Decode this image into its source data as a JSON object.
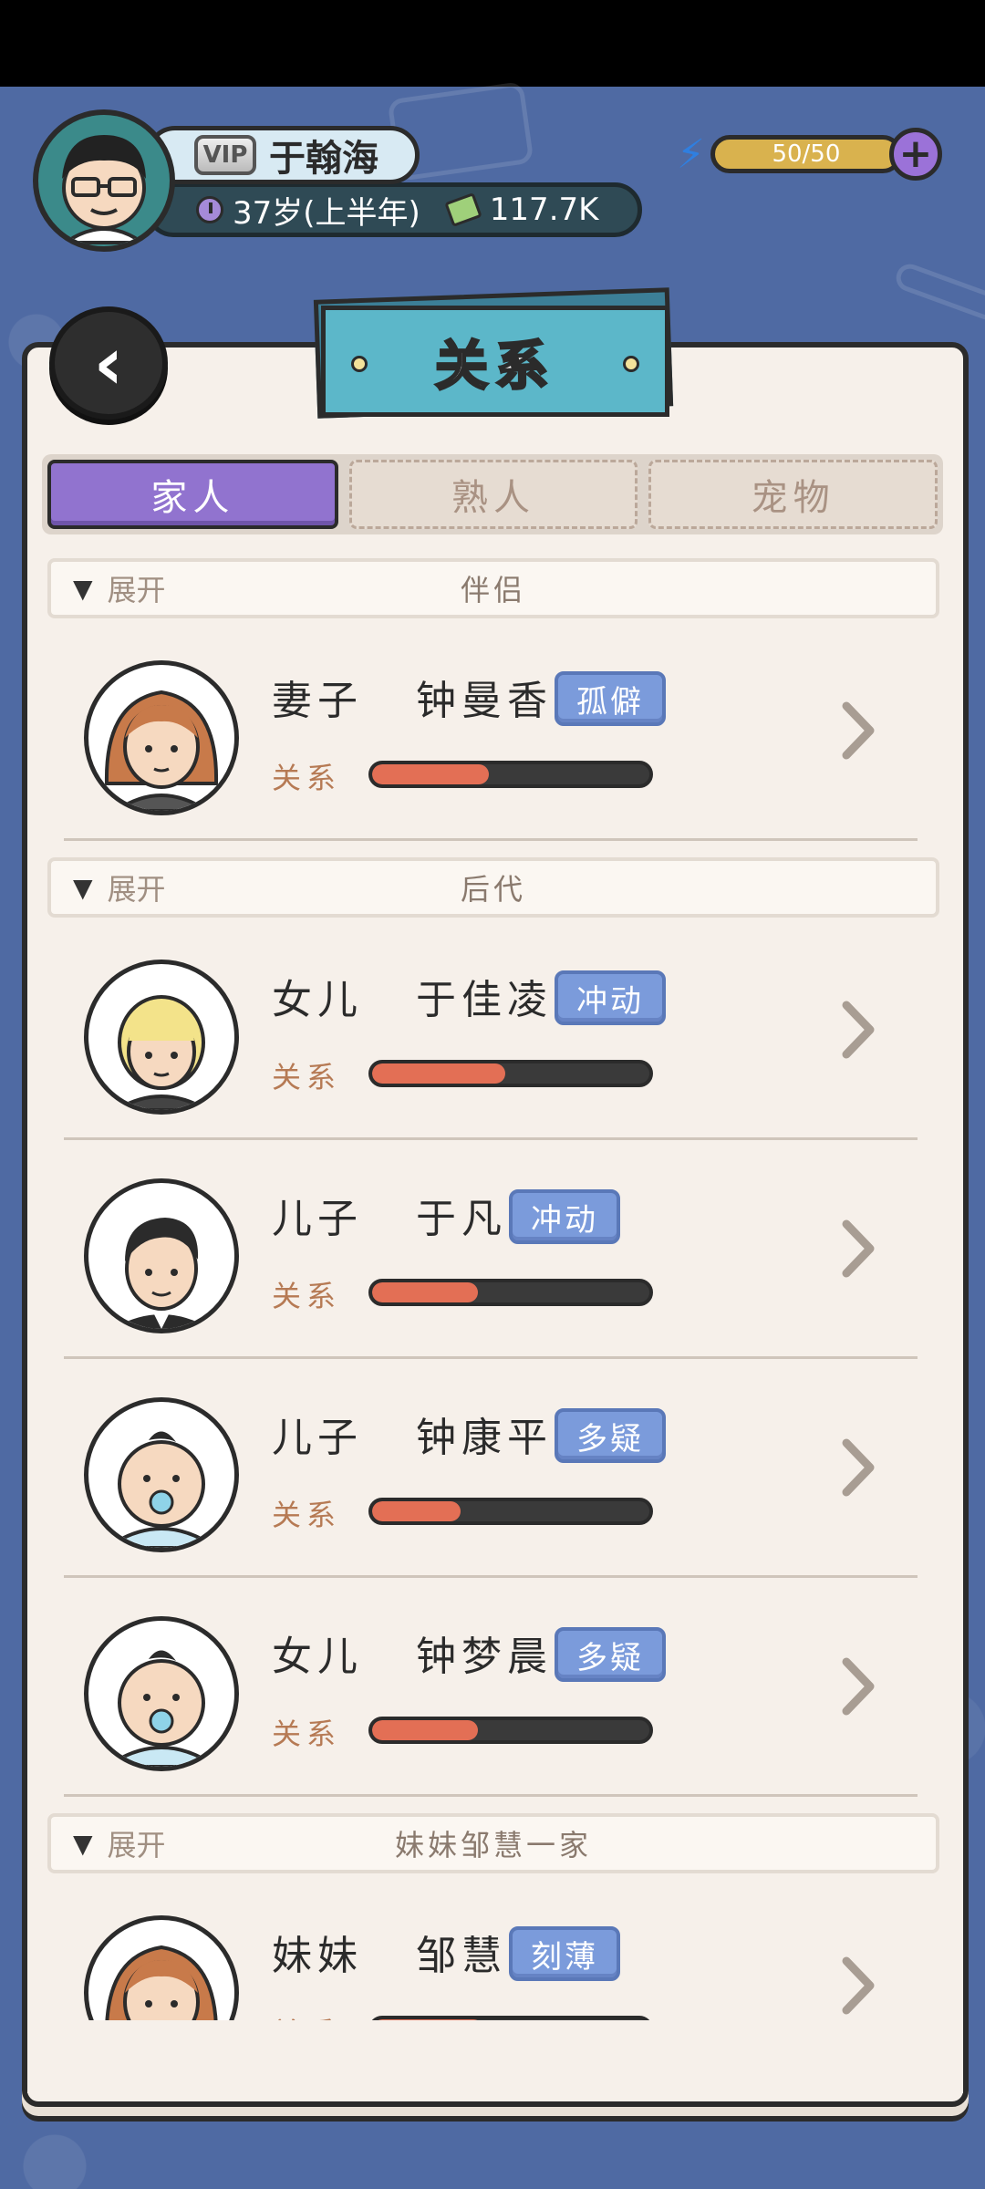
{
  "player": {
    "vip_label": "VIP",
    "name": "于翰海",
    "age": "37岁(上半年)",
    "money": "117.7K"
  },
  "energy": {
    "text": "50/50",
    "fraction": 1.0
  },
  "icons": {
    "back": "back-arrow-icon",
    "energy": "lightning-icon",
    "plus": "plus-icon",
    "clock": "clock-icon",
    "cash": "cash-icon",
    "chevron": "chevron-right-icon"
  },
  "page_title": "关系",
  "tabs": [
    {
      "label": "家人",
      "active": true
    },
    {
      "label": "熟人",
      "active": false
    },
    {
      "label": "宠物",
      "active": false
    }
  ],
  "expand_label": "展开",
  "sections": [
    {
      "title": "伴侣",
      "members": [
        {
          "role": "妻子",
          "name": "钟曼香",
          "trait": "孤僻",
          "relation_label": "关系",
          "relation": 0.42
        }
      ]
    },
    {
      "title": "后代",
      "members": [
        {
          "role": "女儿",
          "name": "于佳凌",
          "trait": "冲动",
          "relation_label": "关系",
          "relation": 0.48
        },
        {
          "role": "儿子",
          "name": "于凡",
          "trait": "冲动",
          "relation_label": "关系",
          "relation": 0.38
        },
        {
          "role": "儿子",
          "name": "钟康平",
          "trait": "多疑",
          "relation_label": "关系",
          "relation": 0.32
        },
        {
          "role": "女儿",
          "name": "钟梦晨",
          "trait": "多疑",
          "relation_label": "关系",
          "relation": 0.38
        }
      ]
    },
    {
      "title": "妹妹邹慧一家",
      "members": [
        {
          "role": "妹妹",
          "name": "邹慧",
          "trait": "刻薄",
          "relation_label": "关系",
          "relation": 0.4
        }
      ]
    }
  ],
  "colors": {
    "background": "#4f6aa3",
    "paper": "#f6f0ea",
    "tab_active": "#9173cf",
    "trait_badge": "#7b9bdb",
    "relation_fill": "#e36f55",
    "title_banner": "#5cb7c9"
  }
}
